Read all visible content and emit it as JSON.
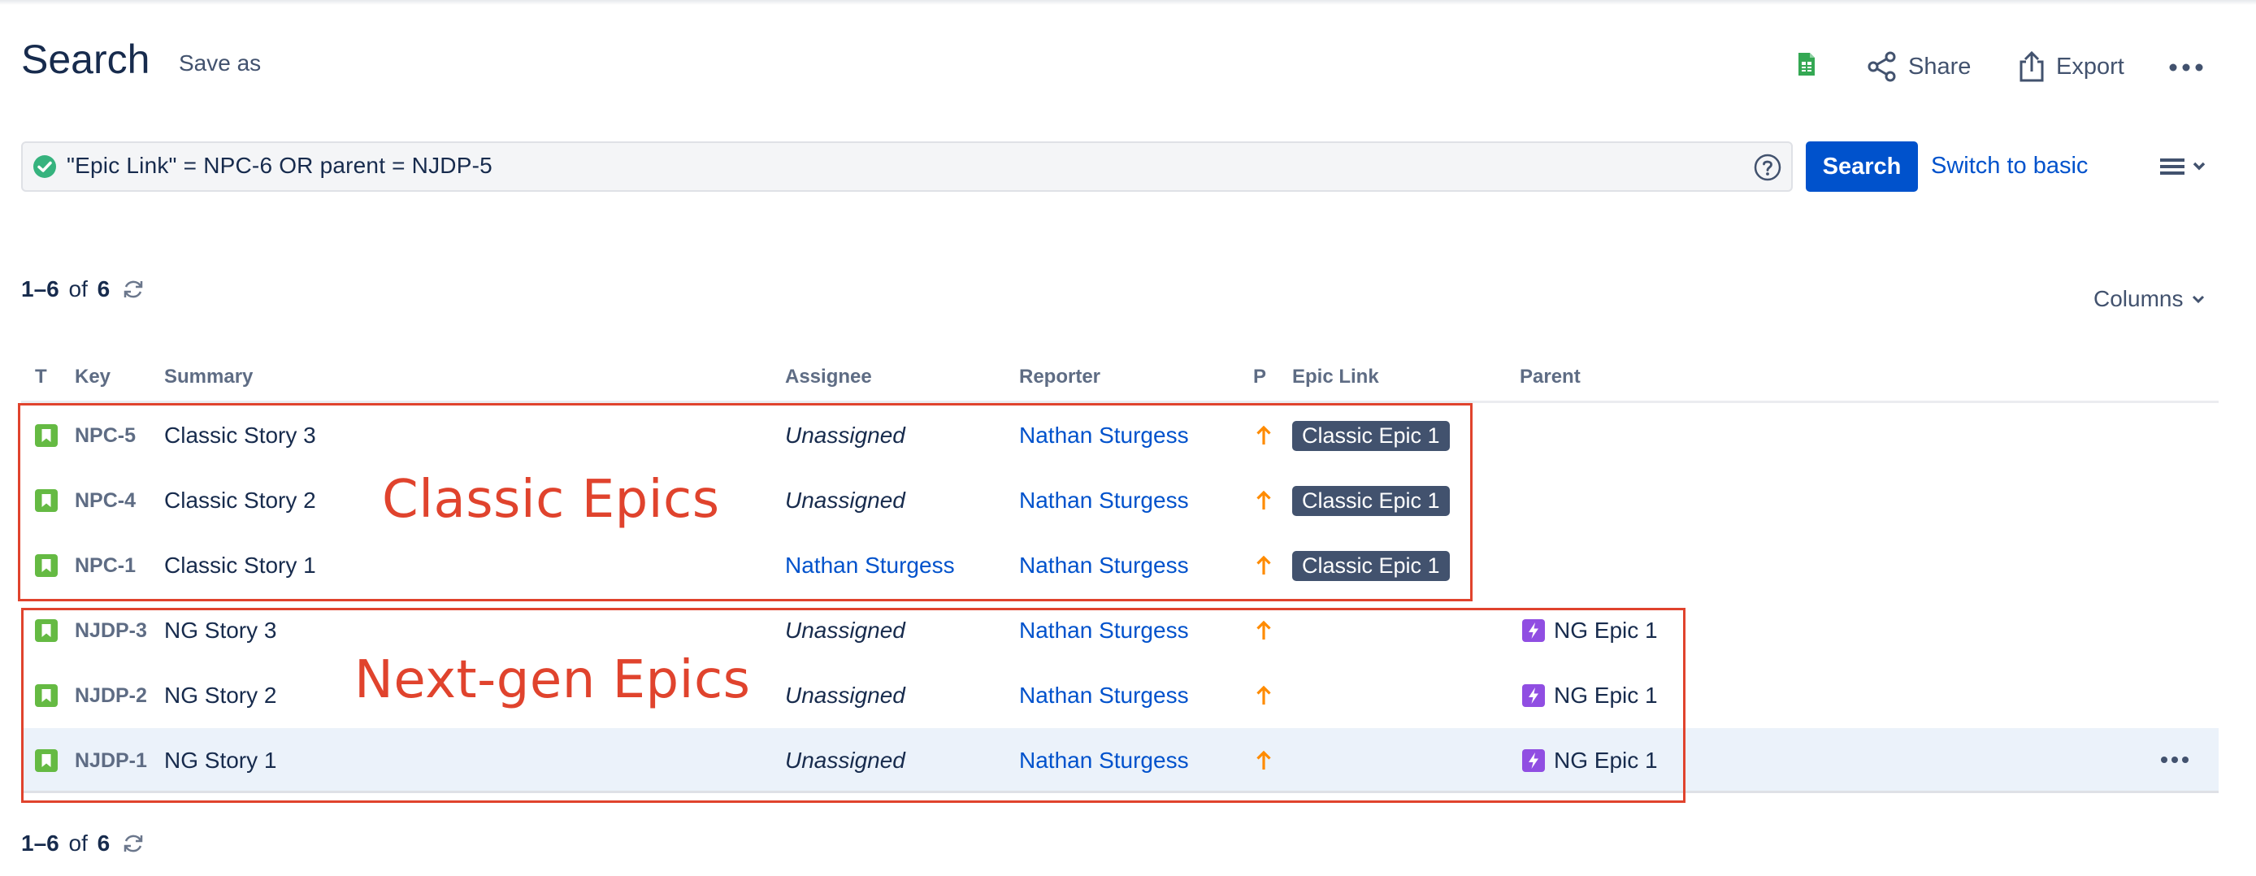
{
  "header": {
    "title": "Search",
    "save_as": "Save as",
    "share_label": "Share",
    "export_label": "Export"
  },
  "jql": {
    "query": "\"Epic Link\" = NPC-6 OR parent = NJDP-5",
    "search_label": "Search",
    "switch_label": "Switch to basic"
  },
  "results": {
    "range": "1–6",
    "of": "of",
    "total": "6",
    "columns_label": "Columns"
  },
  "table": {
    "headers": {
      "t": "T",
      "key": "Key",
      "summary": "Summary",
      "assignee": "Assignee",
      "reporter": "Reporter",
      "p": "P",
      "epic_link": "Epic Link",
      "parent": "Parent"
    },
    "rows": [
      {
        "key": "NPC-5",
        "summary": "Classic Story 3",
        "assignee": "Unassigned",
        "reporter": "Nathan Sturgess",
        "epic_link": "Classic Epic 1",
        "parent": ""
      },
      {
        "key": "NPC-4",
        "summary": "Classic Story 2",
        "assignee": "Unassigned",
        "reporter": "Nathan Sturgess",
        "epic_link": "Classic Epic 1",
        "parent": ""
      },
      {
        "key": "NPC-1",
        "summary": "Classic Story 1",
        "assignee": "Nathan Sturgess",
        "reporter": "Nathan Sturgess",
        "epic_link": "Classic Epic 1",
        "parent": ""
      },
      {
        "key": "NJDP-3",
        "summary": "NG Story 3",
        "assignee": "Unassigned",
        "reporter": "Nathan Sturgess",
        "epic_link": "",
        "parent": "NG Epic 1"
      },
      {
        "key": "NJDP-2",
        "summary": "NG Story 2",
        "assignee": "Unassigned",
        "reporter": "Nathan Sturgess",
        "epic_link": "",
        "parent": "NG Epic 1"
      },
      {
        "key": "NJDP-1",
        "summary": "NG Story 1",
        "assignee": "Unassigned",
        "reporter": "Nathan Sturgess",
        "epic_link": "",
        "parent": "NG Epic 1"
      }
    ]
  },
  "annotations": {
    "classic": "Classic Epics",
    "nextgen": "Next-gen Epics",
    "color": "#e0432d"
  },
  "colors": {
    "primary": "#0052cc",
    "story_icon": "#65ba43",
    "priority": "#ff8b00",
    "epic_icon": "#904ee2",
    "lozenge": "#42526e"
  },
  "icons": {
    "sheets": "sheets-icon",
    "share": "share-icon",
    "export": "export-icon",
    "more": "more-icon",
    "check": "check-circle-icon",
    "help": "help-icon",
    "menu": "menu-icon",
    "refresh": "refresh-icon",
    "story": "story-icon",
    "priority": "priority-high-icon",
    "epic": "epic-icon"
  }
}
